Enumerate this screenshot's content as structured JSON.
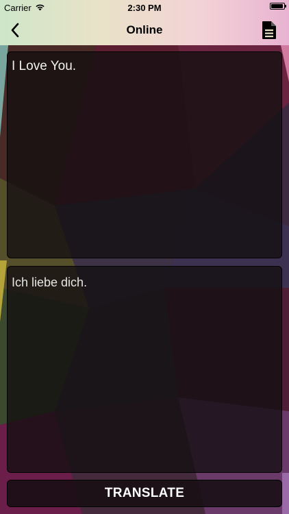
{
  "status_bar": {
    "carrier": "Carrier",
    "time": "2:30 PM",
    "battery_level": 0.95
  },
  "nav": {
    "title": "Online",
    "back_icon": "chevron-left-icon",
    "right_icon": "document-icon"
  },
  "source": {
    "text": "I Love You."
  },
  "target": {
    "text": "Ich liebe dich."
  },
  "actions": {
    "translate_label": "TRANSLATE"
  },
  "colors": {
    "box_background": "#120e10",
    "text_primary": "#f2f2f2",
    "header_left": "#cfe6c8",
    "header_right": "#e8b3d2"
  }
}
